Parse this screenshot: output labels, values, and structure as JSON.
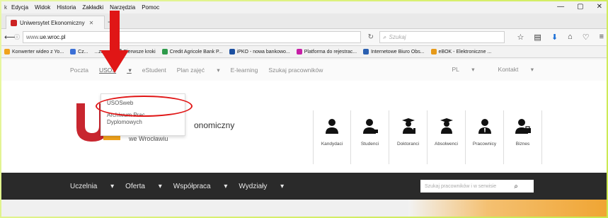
{
  "browser": {
    "menu": [
      "k",
      "Edycja",
      "Widok",
      "Historia",
      "Zakładki",
      "Narzędzia",
      "Pomoc"
    ],
    "tab_title": "Uniwersytet Ekonomiczny",
    "url_prefix": "www.",
    "url_domain": "ue.wroc.pl",
    "search_placeholder": "Szukaj",
    "bookmarks": [
      "Konwerter wideo z Yo...",
      "Cz...",
      "...zane",
      "Pierwsze kroki",
      "Credit Agricole Bank P...",
      "iPKO - nowa bankowo...",
      "Platforma do rejestrac...",
      "Internetowe Biuro Obs...",
      "eBOK - Elektroniczne ..."
    ]
  },
  "site": {
    "topnav": [
      "Poczta",
      "USOS",
      "eStudent",
      "Plan zajęć",
      "E-learning",
      "Szukaj pracowników"
    ],
    "topnav_right": [
      "PL",
      "Kontakt"
    ],
    "dropdown": [
      "USOSweb",
      "Archiwum Prac Dyplomowych"
    ],
    "name_part": "onomiczny",
    "subtitle": "we Wrocławiu",
    "categories": [
      "Kandydaci",
      "Studenci",
      "Doktoranci",
      "Absolwenci",
      "Pracownicy",
      "Biznes"
    ],
    "mainnav": [
      "Uczelnia",
      "Oferta",
      "Współpraca",
      "Wydziały"
    ],
    "search_placeholder": "Szukaj pracowników i w serwisie"
  },
  "colors": {
    "accent_red": "#e01616",
    "dark_bar": "#2a2a2a",
    "logo_red": "#c8262f",
    "logo_yellow": "#f0a21c"
  }
}
